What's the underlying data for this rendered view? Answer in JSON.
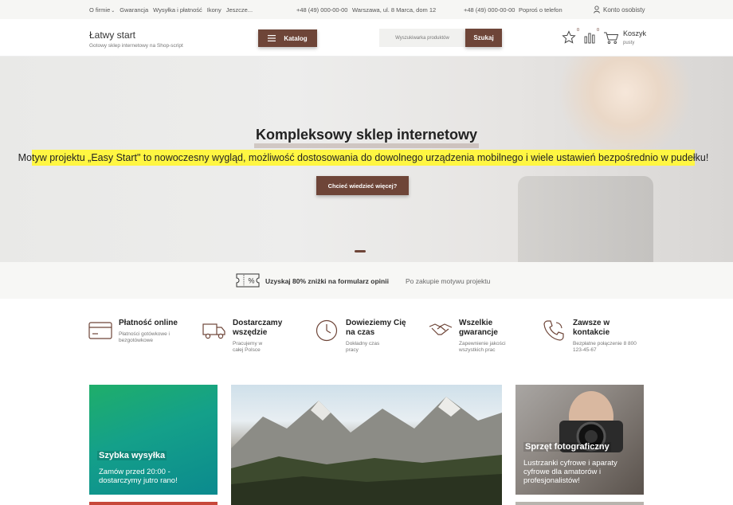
{
  "topbar": {
    "nav": [
      "O firmie",
      "Gwarancja",
      "Wysyłka i płatność",
      "Ikony",
      "Jeszcze..."
    ],
    "phone1": "+48 (49) 000-00-00",
    "address": "Warszawa, ul. 8 Marca, dom 12",
    "phone2": "+48 (49) 000-00-00",
    "callback": "Poproś o telefon",
    "account": "Konto osobisty"
  },
  "header": {
    "brand_name": "Łatwy start",
    "brand_tagline": "Gotowy sklep internetowy na Shop-script",
    "catalog_label": "Katalog",
    "search_placeholder": "Wyszukiwarka produktów",
    "search_button": "Szukaj",
    "favorites_count": "0",
    "compare_count": "0",
    "cart_label": "Koszyk",
    "cart_status": "pusty"
  },
  "hero": {
    "title": "Kompleksowy sklep internetowy",
    "text": "Motyw projektu „Easy Start\" to nowoczesny wygląd, możliwość dostosowania do dowolnego urządzenia mobilnego i wiele ustawień bezpośrednio w pudełku!",
    "button": "Chcieć wiedzieć więcej?"
  },
  "promo": {
    "strong": "Uzyskaj 80% zniżki na formularz opinii",
    "light": "Po zakupie motywu projektu"
  },
  "features": [
    {
      "title": "Płatność online",
      "subtitle": "Płatności gotówkowe i bezgotówkowe"
    },
    {
      "title": "Dostarczamy wszędzie",
      "subtitle": "Pracujemy w całej Polsce"
    },
    {
      "title": "Dowieziemy Cię na czas",
      "subtitle": "Dokładny czas pracy"
    },
    {
      "title": "Wszelkie gwarancje",
      "subtitle": "Zapewnienie jakości wszystkich prac"
    },
    {
      "title": "Zawsze w kontakcie",
      "subtitle": "Bezpłatne połączenie 8 800 123-45-67"
    }
  ],
  "tiles": [
    {
      "title": "Szybka wysyłka",
      "text": "Zamów przed 20:00 - dostarczymy jutro rano!"
    },
    {
      "title": "Sprzęt fotograficzny",
      "text": "Lustrzanki cyfrowe i aparaty cyfrowe dla amatorów i profesjonalistów!"
    }
  ],
  "colors": {
    "accent": "#6e4538",
    "highlight": "#fff642",
    "tile_green": "#14a08a"
  }
}
